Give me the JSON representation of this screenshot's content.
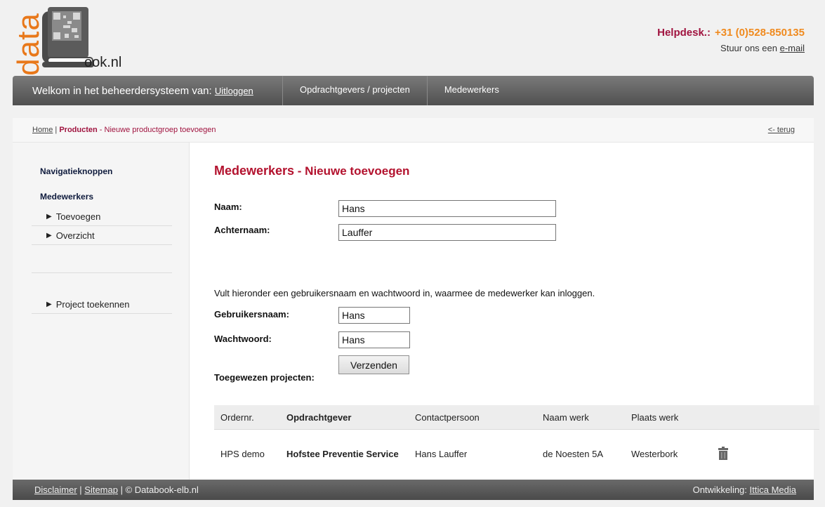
{
  "brand": {
    "logo_vertical": "data",
    "logo_suffix": "ook.nl"
  },
  "helpdesk": {
    "label": "Helpdesk.:",
    "phone": "+31 (0)528-850135",
    "mail_prefix": "Stuur ons een ",
    "mail_link": "e-mail"
  },
  "topnav": {
    "welcome": "Welkom in het beheerdersysteem van: ",
    "logout": "Uitloggen",
    "tabs": [
      "Opdrachtgevers / projecten",
      "Medewerkers"
    ]
  },
  "breadcrumb": {
    "home": "Home",
    "sep": " | ",
    "current": "Producten",
    "rest": " - Nieuwe productgroep toevoegen",
    "back": "<- terug"
  },
  "sidebar": {
    "nav_title": "Navigatieknoppen",
    "section_title": "Medewerkers",
    "items": [
      "Toevoegen",
      "Overzicht",
      "Project toekennen"
    ]
  },
  "form": {
    "heading": "Medewerkers",
    "heading_sub": " - Nieuwe toevoegen",
    "naam_label": "Naam:",
    "naam_value": "Hans",
    "achternaam_label": "Achternaam:",
    "achternaam_value": "Lauffer",
    "note": "Vult hieronder een gebruikersnaam en wachtwoord in, waarmee de medewerker kan inloggen.",
    "user_label": "Gebruikersnaam:",
    "user_value": "Hans",
    "pass_label": "Wachtwoord:",
    "pass_value": "Hans",
    "submit": "Verzenden"
  },
  "projects": {
    "title": "Toegewezen projecten:",
    "headers": [
      "Ordernr.",
      "Opdrachtgever",
      "Contactpersoon",
      "Naam werk",
      "Plaats werk"
    ],
    "rows": [
      [
        "HPS demo",
        "Hofstee Preventie Service",
        "Hans Lauffer",
        "de Noesten 5A",
        "Westerbork"
      ]
    ]
  },
  "footer": {
    "disclaimer": "Disclaimer",
    "sitemap": "Sitemap",
    "copyright": "© Databook-elb.nl",
    "dev_label": "Ontwikkeling: ",
    "dev_link": "Ittica Media"
  },
  "colors": {
    "brand_red": "#a0133f",
    "heading_red": "#b3122e",
    "accent_orange": "#f08a1e"
  }
}
